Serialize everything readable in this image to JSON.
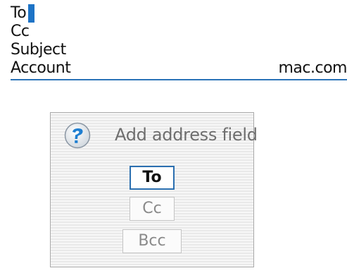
{
  "compose": {
    "to_label": "To",
    "cc_label": "Cc",
    "subject_label": "Subject",
    "account_label": "Account",
    "account_value": "mac.com"
  },
  "dialog": {
    "title": "Add address field",
    "icon": "help-question-icon",
    "options": [
      "To",
      "Cc",
      "Bcc"
    ],
    "selected": "To"
  },
  "colors": {
    "accent": "#2b73b8",
    "cursor": "#1d73c6",
    "dialog_text": "#6e6e6e"
  }
}
